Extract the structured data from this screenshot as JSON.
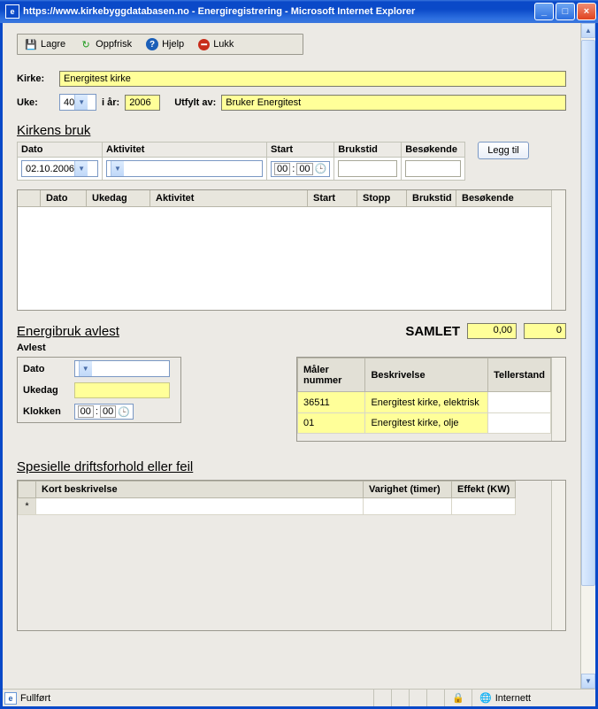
{
  "window": {
    "title": "https://www.kirkebyggdatabasen.no - Energiregistrering - Microsoft Internet Explorer"
  },
  "toolbar": {
    "save": "Lagre",
    "refresh": "Oppfrisk",
    "help": "Hjelp",
    "close": "Lukk"
  },
  "header": {
    "kirke_label": "Kirke:",
    "kirke_value": "Energitest kirke",
    "uke_label": "Uke:",
    "uke_value": "40",
    "iaar_label": "i år:",
    "iaar_value": "2006",
    "utfylt_label": "Utfylt av:",
    "utfylt_value": "Bruker Energitest"
  },
  "kirkens_bruk": {
    "title": "Kirkens bruk",
    "cols": {
      "dato": "Dato",
      "aktivitet": "Aktivitet",
      "start": "Start",
      "brukstid": "Brukstid",
      "besok": "Besøkende"
    },
    "dato_value": "02.10.2006",
    "start_hh": "00",
    "start_mm": "00",
    "add_btn": "Legg til",
    "list_cols": {
      "dato": "Dato",
      "ukedag": "Ukedag",
      "aktivitet": "Aktivitet",
      "start": "Start",
      "stopp": "Stopp",
      "brukstid": "Brukstid",
      "besok": "Besøkende"
    }
  },
  "energibruk": {
    "title": "Energibruk avlest",
    "samlet_label": "SAMLET",
    "samlet_a": "0,00",
    "samlet_b": "0",
    "avlest_label": "Avlest",
    "dato_label": "Dato",
    "ukedag_label": "Ukedag",
    "klokken_label": "Klokken",
    "klokken_hh": "00",
    "klokken_mm": "00",
    "meter_cols": {
      "num": "Måler nummer",
      "besk": "Beskrivelse",
      "stand": "Tellerstand"
    },
    "meters": [
      {
        "num": "36511",
        "besk": "Energitest kirke, elektrisk",
        "stand": ""
      },
      {
        "num": "01",
        "besk": "Energitest kirke, olje",
        "stand": ""
      }
    ]
  },
  "drift": {
    "title": "Spesielle driftsforhold eller feil",
    "cols": {
      "besk": "Kort beskrivelse",
      "var": "Varighet (timer)",
      "eff": "Effekt (KW)"
    },
    "new_marker": "*"
  },
  "status": {
    "left": "Fullført",
    "right": "Internett"
  }
}
